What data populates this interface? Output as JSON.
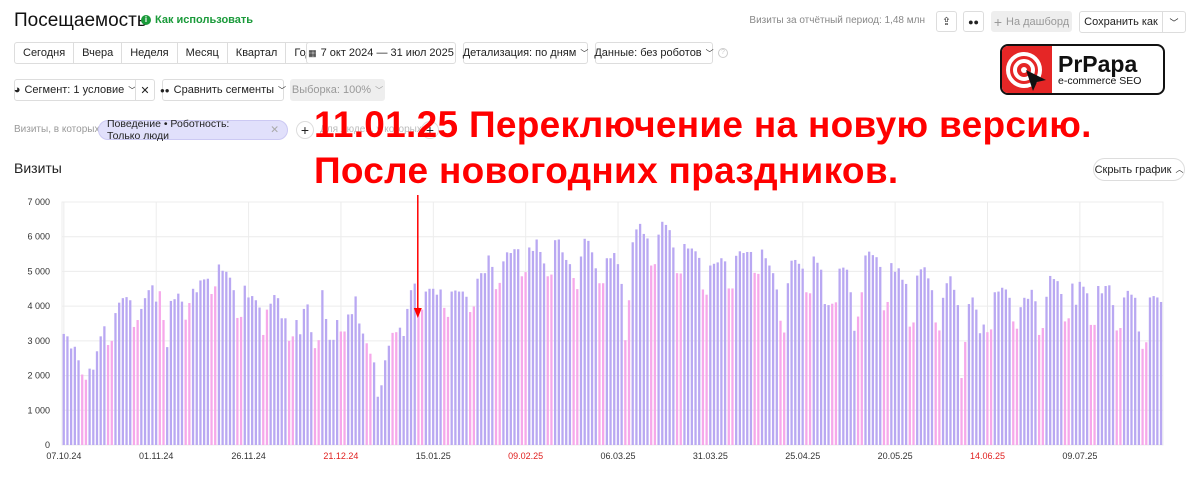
{
  "header": {
    "title": "Посещаемость",
    "how_to": "Как использовать",
    "total": "Визиты за отчётный период: 1,48 млн",
    "to_dashboard": "На дашборд",
    "save_as": "Сохранить как"
  },
  "periods": [
    "Сегодня",
    "Вчера",
    "Неделя",
    "Месяц",
    "Квартал",
    "Год"
  ],
  "date_range": "7 окт 2024 — 31 июл 2025",
  "detail": "Детализация: по дням",
  "data_filter": "Данные: без роботов",
  "segment": "Сегмент: 1 условие",
  "compare": "Сравнить сегменты",
  "sample": "Выборка: 100%",
  "filter": {
    "label": "Визиты, в которых",
    "chip": "Поведение • Роботность: Только люди",
    "people_label": "Для людей, у которых"
  },
  "chart_header": {
    "title": "Визиты",
    "hide": "Скрыть график"
  },
  "annotation": {
    "line1": "11.01.25 Переключение на новую версию.",
    "line2": "После новогодних праздников."
  },
  "logo": {
    "name": "PrPapa",
    "tagline": "e-commerce SEO"
  },
  "colors": {
    "weekday": "#b9a8f2",
    "weekend": "#f6a8ea",
    "annotation": "#ff0000",
    "red_date": "#e0201f"
  },
  "chart_data": {
    "type": "bar",
    "title": "Визиты",
    "xlabel": "",
    "ylabel": "",
    "ylim": [
      0,
      7000
    ],
    "yticks": [
      "0",
      "1 000",
      "2 000",
      "3 000",
      "4 000",
      "5 000",
      "6 000",
      "7 000"
    ],
    "start_date": "07.10.24",
    "end_date": "31.07.25",
    "xticks": [
      {
        "label": "07.10.24",
        "day": 0,
        "red": false
      },
      {
        "label": "01.11.24",
        "day": 25,
        "red": false
      },
      {
        "label": "26.11.24",
        "day": 50,
        "red": false
      },
      {
        "label": "21.12.24",
        "day": 75,
        "red": true
      },
      {
        "label": "15.01.25",
        "day": 100,
        "red": false
      },
      {
        "label": "09.02.25",
        "day": 125,
        "red": true
      },
      {
        "label": "06.03.25",
        "day": 150,
        "red": false
      },
      {
        "label": "31.03.25",
        "day": 175,
        "red": false
      },
      {
        "label": "25.04.25",
        "day": 200,
        "red": false
      },
      {
        "label": "20.05.25",
        "day": 225,
        "red": false
      },
      {
        "label": "14.06.25",
        "day": 250,
        "red": true
      },
      {
        "label": "09.07.25",
        "day": 275,
        "red": false
      }
    ],
    "annotation_day": 96,
    "values": [
      3200,
      3130,
      2780,
      2830,
      2440,
      2030,
      1880,
      2200,
      2170,
      2700,
      3130,
      3420,
      2880,
      3000,
      3800,
      4100,
      4230,
      4260,
      4170,
      3400,
      3600,
      3920,
      4230,
      4460,
      4600,
      4130,
      4430,
      3600,
      2820,
      4150,
      4200,
      4360,
      4130,
      3610,
      4090,
      4500,
      4400,
      4740,
      4770,
      4790,
      4350,
      4570,
      5200,
      5020,
      4990,
      4820,
      4460,
      3660,
      3690,
      4590,
      4250,
      4290,
      4170,
      3960,
      3170,
      3900,
      4070,
      4320,
      4230,
      3650,
      3650,
      3000,
      3130,
      3600,
      3190,
      3920,
      4050,
      3250,
      2790,
      3020,
      4460,
      3630,
      3030,
      3030,
      3600,
      3270,
      3270,
      3760,
      3770,
      4280,
      3500,
      3210,
      2930,
      2630,
      2380,
      1390,
      1720,
      2440,
      2860,
      3230,
      3250,
      3380,
      3140,
      3920,
      4460,
      4650,
      3960,
      3900,
      4420,
      4500,
      4500,
      4330,
      4480,
      3950,
      3690,
      4420,
      4450,
      4420,
      4420,
      4270,
      3830,
      3990,
      4790,
      4950,
      4950,
      5460,
      5130,
      4490,
      4670,
      5290,
      5550,
      5530,
      5640,
      5640,
      4860,
      4980,
      5690,
      5590,
      5920,
      5560,
      5230,
      4860,
      4910,
      5900,
      5920,
      5550,
      5330,
      5210,
      4810,
      4490,
      5430,
      5940,
      5880,
      5550,
      5090,
      4660,
      4660,
      5380,
      5380,
      5530,
      5210,
      4640,
      3020,
      4170,
      5840,
      6210,
      6370,
      6080,
      5950,
      5170,
      5210,
      6060,
      6430,
      6340,
      6190,
      5690,
      4950,
      4940,
      5790,
      5660,
      5660,
      5580,
      5390,
      4480,
      4330,
      5170,
      5220,
      5260,
      5380,
      5290,
      4510,
      4510,
      5450,
      5580,
      5530,
      5560,
      5560,
      4960,
      4930,
      5630,
      5380,
      5170,
      4950,
      4480,
      3580,
      3240,
      4660,
      5310,
      5330,
      5220,
      5080,
      4400,
      4370,
      5430,
      5250,
      5050,
      4060,
      4030,
      4070,
      4110,
      5080,
      5110,
      5050,
      4400,
      3290,
      3700,
      4400,
      5460,
      5570,
      5470,
      5410,
      5130,
      3880,
      4120,
      5240,
      4990,
      5090,
      4760,
      4640,
      3410,
      3530,
      4880,
      5060,
      5120,
      4800,
      4460,
      3530,
      3300,
      4240,
      4660,
      4860,
      4470,
      4030,
      1930,
      2970,
      4060,
      4250,
      3900,
      3220,
      3470,
      3250,
      3330,
      4400,
      4420,
      4530,
      4480,
      4240,
      3560,
      3350,
      3970,
      4240,
      4210,
      4470,
      4140,
      3170,
      3370,
      4270,
      4870,
      4780,
      4720,
      4350,
      3560,
      3650,
      4650,
      4040,
      4700,
      4560,
      4370,
      3460,
      3460,
      4580,
      4370,
      4580,
      4600,
      4030,
      3300,
      3370,
      4250,
      4440,
      4330,
      4240,
      3270,
      2770,
      2960,
      4250,
      4290,
      4250,
      4120
    ]
  }
}
